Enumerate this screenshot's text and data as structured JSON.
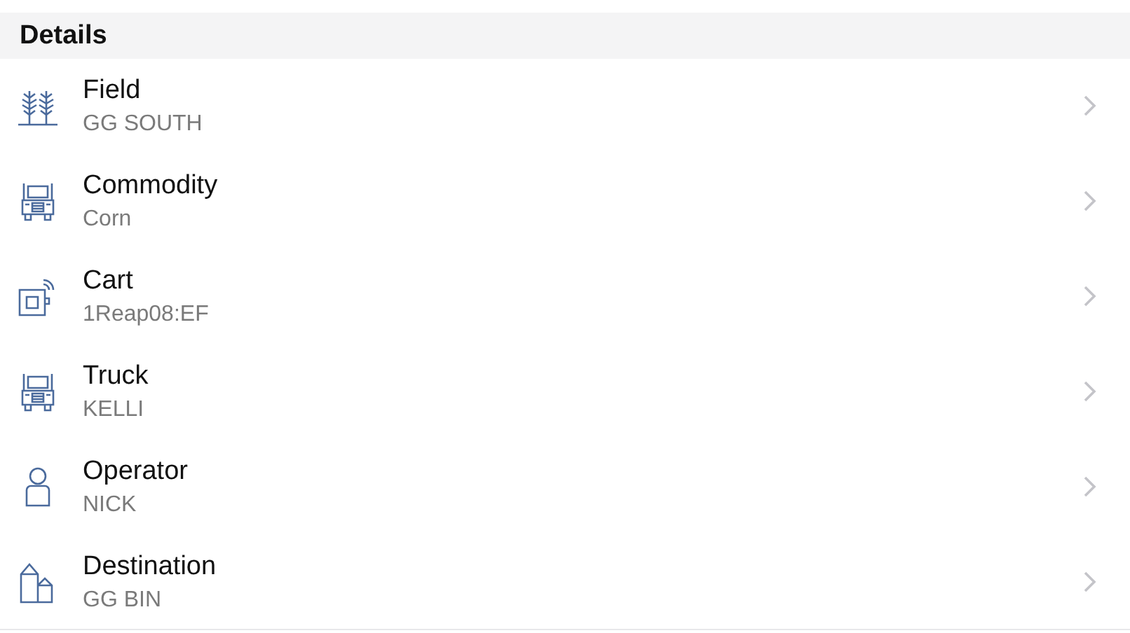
{
  "section": {
    "title": "Details"
  },
  "rows": [
    {
      "kind": "field",
      "label": "Field",
      "value": "GG SOUTH"
    },
    {
      "kind": "truck",
      "label": "Commodity",
      "value": "Corn"
    },
    {
      "kind": "cart",
      "label": "Cart",
      "value": "1Reap08:EF"
    },
    {
      "kind": "truck",
      "label": "Truck",
      "value": "KELLI"
    },
    {
      "kind": "operator",
      "label": "Operator",
      "value": "NICK"
    },
    {
      "kind": "destination",
      "label": "Destination",
      "value": "GG BIN"
    }
  ]
}
